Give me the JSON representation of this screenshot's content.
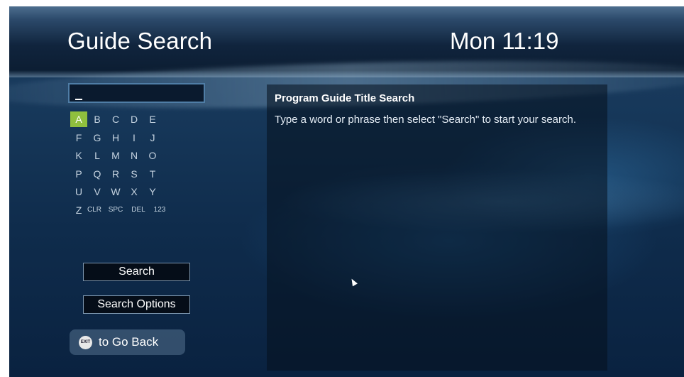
{
  "header": {
    "title": "Guide Search",
    "clock": "Mon 11:19"
  },
  "search_input": {
    "value": ""
  },
  "keyboard": {
    "selected": "A",
    "rows": [
      [
        "A",
        "B",
        "C",
        "D",
        "E"
      ],
      [
        "F",
        "G",
        "H",
        "I",
        "J"
      ],
      [
        "K",
        "L",
        "M",
        "N",
        "O"
      ],
      [
        "P",
        "Q",
        "R",
        "S",
        "T"
      ],
      [
        "U",
        "V",
        "W",
        "X",
        "Y"
      ],
      [
        "Z",
        "CLR",
        "SPC",
        "DEL",
        "123"
      ]
    ]
  },
  "buttons": {
    "search": "Search",
    "search_options": "Search Options"
  },
  "back": {
    "icon_label": "EXIT",
    "label": "to Go Back"
  },
  "info": {
    "title": "Program Guide Title Search",
    "body": "Type a word or phrase then select \"Search\" to start your search."
  },
  "colors": {
    "selected_key": "#8fbf3e",
    "background": "#0f2c4c"
  }
}
